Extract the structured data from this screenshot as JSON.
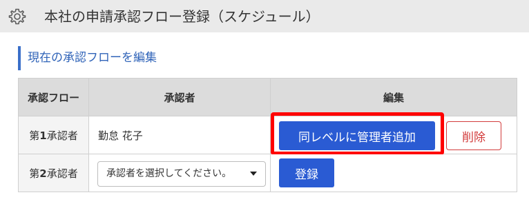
{
  "header": {
    "title": "本社の申請承認フロー登録（スケジュール）",
    "icon": "gear-icon"
  },
  "section": {
    "heading": "現在の承認フローを編集",
    "accent_color": "#3a6fc9"
  },
  "table": {
    "columns": [
      "承認フロー",
      "承認者",
      "編集"
    ],
    "rows": [
      {
        "level_prefix": "第",
        "level_num": "1",
        "level_suffix": "承認者",
        "approver": "勤怠 花子",
        "primary_button": "同レベルに管理者追加",
        "danger_button": "削除"
      },
      {
        "level_prefix": "第",
        "level_num": "2",
        "level_suffix": "承認者",
        "select_value": "承認者を選択してください。",
        "primary_button": "登録"
      }
    ]
  },
  "colors": {
    "primary": "#2a5bd3",
    "danger": "#d23b3b",
    "highlight": "#ff0000"
  }
}
